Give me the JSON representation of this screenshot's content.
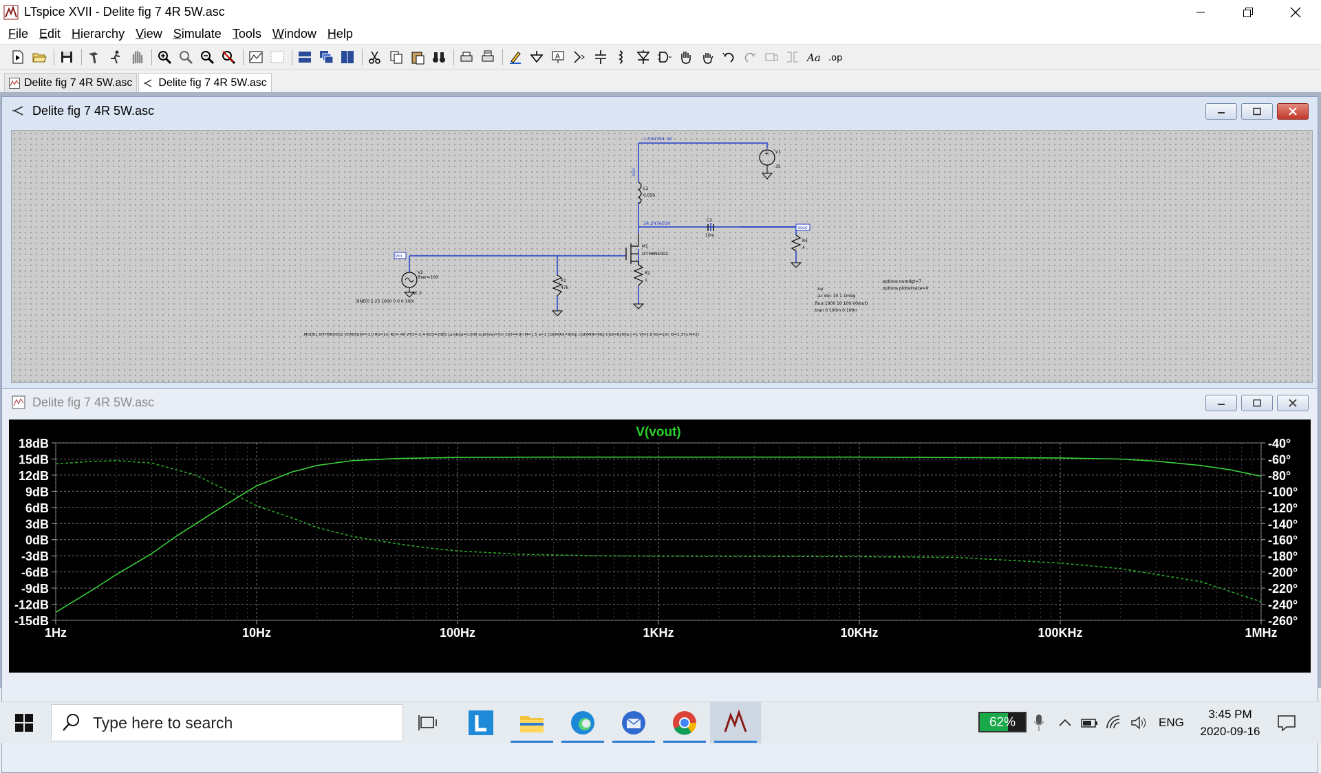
{
  "window": {
    "title": "LTspice XVII - Delite fig 7 4R 5W.asc"
  },
  "menu": [
    {
      "label": "File",
      "key": "F",
      "rest": "ile"
    },
    {
      "label": "Edit",
      "key": "E",
      "rest": "dit"
    },
    {
      "label": "Hierarchy",
      "key": "H",
      "rest": "ierarchy"
    },
    {
      "label": "View",
      "key": "V",
      "rest": "iew"
    },
    {
      "label": "Simulate",
      "key": "S",
      "rest": "imulate"
    },
    {
      "label": "Tools",
      "key": "T",
      "rest": "ools"
    },
    {
      "label": "Window",
      "key": "W",
      "rest": "indow"
    },
    {
      "label": "Help",
      "key": "H",
      "rest": "elp"
    }
  ],
  "tabs": [
    {
      "label": "Delite fig 7 4R 5W.asc",
      "kind": "waveform"
    },
    {
      "label": "Delite fig 7 4R 5W.asc",
      "kind": "schematic",
      "active": true
    }
  ],
  "schematic_window": {
    "title": "Delite fig 7 4R 5W.asc",
    "labels": {
      "v1_current": "1.504794 3A",
      "node_top": "35V",
      "l1_name": "L1",
      "l1_value": "0.050",
      "v1_name": "V1",
      "v1_value": "35",
      "node_drain": "34.247603V",
      "c2_name": "C2",
      "c2_value": "10m",
      "vout_flag": "Vout",
      "r4_name": "R4",
      "r4_value": "4",
      "m1_name": "M1",
      "m1_model": "IXTH6N50D2",
      "vin_flag": "Vin",
      "v2_name": "V2",
      "v2_rser": "Rser=100",
      "v2_ac": "AC 2",
      "r1_name": "R1",
      "r1_value": "47k",
      "r2_name": "R2",
      "r2_value": "1",
      "v2_sine": "SINE(0 2.25 1000 0 0 0 100)",
      "dir_op": ";op",
      "dir_ac": ";ac dec 10 1 1meg",
      "dir_four": ".four 1000 10 100 V(Vout)",
      "dir_tran": ";tran 0 100m 0 100n",
      "opt1": ".options numdgt=7",
      "opt2": ".options plotwinsize=0",
      "model_line": ".MODEL IXTH6N50D2 VDMOS(KP=3.0 RS=1m RD=.49 VTO=-2.4 RDS=20E6 Lambda=0.008 subthres=5m CJO=4.9n M=1.5 a=1 CGDMAX=900p CGDMIN=80p CGS=6200p n=1 VJ=2.8 KG=10n IS=1.37u N=2)"
    }
  },
  "waveform_window": {
    "title": "Delite fig 7 4R 5W.asc"
  },
  "chart_data": {
    "type": "line",
    "title": "V(vout)",
    "x_scale": "log",
    "x_ticks": [
      "1Hz",
      "10Hz",
      "100Hz",
      "1KHz",
      "10KHz",
      "100KHz",
      "1MHz"
    ],
    "xlim": [
      1,
      1000000
    ],
    "y_left_ticks": [
      "18dB",
      "15dB",
      "12dB",
      "9dB",
      "6dB",
      "3dB",
      "0dB",
      "-3dB",
      "-6dB",
      "-9dB",
      "-12dB",
      "-15dB"
    ],
    "y_left_lim": [
      -15,
      18
    ],
    "y_right_ticks": [
      "-40°",
      "-60°",
      "-80°",
      "-100°",
      "-120°",
      "-140°",
      "-160°",
      "-180°",
      "-200°",
      "-220°",
      "-240°",
      "-260°"
    ],
    "y_right_lim": [
      -260,
      -40
    ],
    "grid": true,
    "series": [
      {
        "style": "solid",
        "axis": "left",
        "color": "#3ad03a",
        "x": [
          1,
          1.5,
          2,
          3,
          4,
          5,
          6,
          8,
          10,
          15,
          20,
          30,
          50,
          100,
          300,
          1000,
          10000,
          100000,
          200000,
          300000,
          500000,
          700000,
          1000000
        ],
        "y": [
          -13.5,
          -9.5,
          -6.5,
          -2.6,
          0.7,
          3.0,
          4.9,
          7.8,
          10,
          12.6,
          13.8,
          14.7,
          15.1,
          15.3,
          15.35,
          15.35,
          15.35,
          15.2,
          15.0,
          14.6,
          13.8,
          13.0,
          11.8
        ]
      },
      {
        "style": "dashed",
        "axis": "right",
        "color": "#2aa82a",
        "x": [
          1,
          1.5,
          2,
          3,
          5,
          7,
          10,
          15,
          20,
          30,
          50,
          70,
          100,
          200,
          500,
          1000,
          10000,
          30000,
          100000,
          200000,
          300000,
          500000,
          1000000
        ],
        "y": [
          -66,
          -63,
          -62,
          -65,
          -80,
          -98,
          -118,
          -133,
          -145,
          -156,
          -165,
          -170,
          -174,
          -178,
          -180,
          -180.5,
          -181,
          -182,
          -189,
          -196,
          -203,
          -212,
          -237
        ]
      }
    ]
  },
  "taskbar": {
    "search_placeholder": "Type here to search",
    "battery_pct": "62%",
    "battery_level": 0.62,
    "lang": "ENG",
    "time": "3:45 PM",
    "date": "2020-09-16",
    "apps": [
      "task-view",
      "lightshot",
      "file-explorer",
      "edge",
      "thunderbird",
      "chrome",
      "ltspice"
    ]
  }
}
